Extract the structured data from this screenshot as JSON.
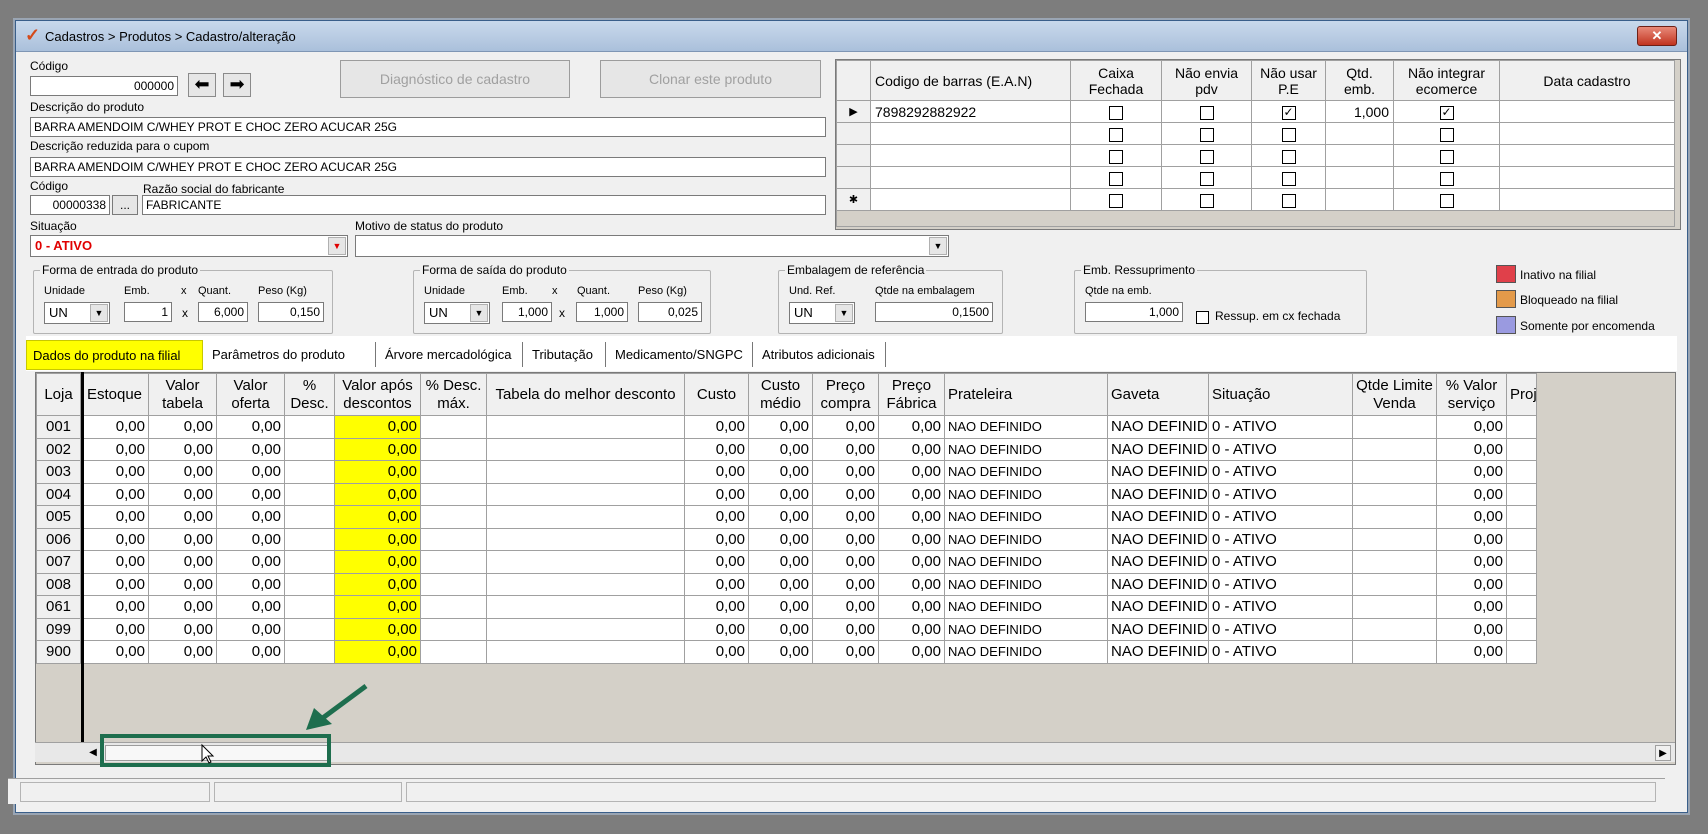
{
  "window": {
    "title": "Cadastros > Produtos > Cadastro/alteração",
    "close": "✕"
  },
  "product": {
    "codigo_label": "Código",
    "codigo": "000000",
    "descricao_label": "Descrição  do produto",
    "descricao": "BARRA AMENDOIM C/WHEY PROT E CHOC ZERO ACUCAR 25G",
    "descricao_cupom_label": "Descrição reduzida para o cupom",
    "descricao_cupom": "BARRA AMENDOIM C/WHEY PROT E CHOC ZERO ACUCAR 25G",
    "fab_codigo_label": "Código",
    "fab_codigo": "00000338",
    "fab_lookup": "...",
    "razao_label": "Razão social do fabricante",
    "razao": "FABRICANTE",
    "situacao_label": "Situação",
    "situacao": "0 - ATIVO",
    "motivo_label": "Motivo de status do produto",
    "motivo": ""
  },
  "buttons": {
    "diagnostico": "Diagnóstico de cadastro",
    "clonar": "Clonar este produto"
  },
  "ean_grid": {
    "headers": [
      "Codigo de barras (E.A.N)",
      "Caixa\nFechada",
      "Não envia\npdv",
      "Não usar\nP.E",
      "Qtd.\nemb.",
      "Não integrar\necomerce",
      "Data cadastro"
    ],
    "rows": [
      {
        "indicator": "▶",
        "ean": "7898292882922",
        "caixa": false,
        "nao_envia": false,
        "nao_usar": true,
        "qtd": "1,000",
        "nao_integrar": true,
        "data": ""
      },
      {
        "indicator": "",
        "ean": "",
        "caixa": false,
        "nao_envia": false,
        "nao_usar": false,
        "qtd": "",
        "nao_integrar": false,
        "data": ""
      },
      {
        "indicator": "",
        "ean": "",
        "caixa": false,
        "nao_envia": false,
        "nao_usar": false,
        "qtd": "",
        "nao_integrar": false,
        "data": ""
      },
      {
        "indicator": "",
        "ean": "",
        "caixa": false,
        "nao_envia": false,
        "nao_usar": false,
        "qtd": "",
        "nao_integrar": false,
        "data": ""
      },
      {
        "indicator": "✱",
        "ean": "",
        "caixa": false,
        "nao_envia": false,
        "nao_usar": false,
        "qtd": "",
        "nao_integrar": false,
        "data": ""
      }
    ]
  },
  "entrada": {
    "title": "Forma de entrada do produto",
    "unidade_label": "Unidade",
    "emb_label": "Emb.",
    "x": "x",
    "quant_label": "Quant.",
    "peso_label": "Peso (Kg)",
    "unidade": "UN",
    "emb": "1",
    "quant": "6,000",
    "peso": "0,150"
  },
  "saida": {
    "title": "Forma de saída do produto",
    "unidade_label": "Unidade",
    "emb_label": "Emb.",
    "x": "x",
    "quant_label": "Quant.",
    "peso_label": "Peso (Kg)",
    "unidade": "UN",
    "emb": "1,000",
    "quant": "1,000",
    "peso": "0,025"
  },
  "referencia": {
    "title": "Embalagem de referência",
    "und_label": "Und. Ref.",
    "qtde_label": "Qtde na embalagem",
    "und": "UN",
    "qtde": "0,1500"
  },
  "ressup": {
    "title": "Emb. Ressuprimento",
    "qtde_label": "Qtde na emb.",
    "qtde": "1,000",
    "check_label": "Ressup. em cx fechada"
  },
  "legend": [
    {
      "label": "Inativo na filial",
      "color": "#e0404a"
    },
    {
      "label": "Bloqueado na filial",
      "color": "#e39a4a"
    },
    {
      "label": "Somente por encomenda",
      "color": "#9a9ae0"
    }
  ],
  "tabs": [
    "Dados do produto na filial",
    "Parâmetros do produto",
    "Árvore mercadológica",
    "Tributação",
    "Medicamento/SNGPC",
    "Atributos adicionais"
  ],
  "main_grid": {
    "headers": [
      "Loja",
      "Estoque",
      "Valor\ntabela",
      "Valor\noferta",
      "%\nDesc.",
      "Valor após\ndescontos",
      "% Desc.\nmáx.",
      "Tabela do melhor desconto",
      "Custo",
      "Custo\nmédio",
      "Preço\ncompra",
      "Preço\nFábrica",
      "Prateleira",
      "Gaveta",
      "Situação",
      "Qtde Limite\nVenda",
      "% Valor\nserviço",
      "Proj"
    ],
    "rows": [
      [
        "001",
        "0,00",
        "0,00",
        "0,00",
        "",
        "0,00",
        "",
        "",
        "0,00",
        "0,00",
        "0,00",
        "0,00",
        "NAO DEFINIDO",
        "NAO DEFINIDO",
        "0 - ATIVO",
        "",
        "0,00",
        ""
      ],
      [
        "002",
        "0,00",
        "0,00",
        "0,00",
        "",
        "0,00",
        "",
        "",
        "0,00",
        "0,00",
        "0,00",
        "0,00",
        "NAO DEFINIDO",
        "NAO DEFINIDO",
        "0 - ATIVO",
        "",
        "0,00",
        ""
      ],
      [
        "003",
        "0,00",
        "0,00",
        "0,00",
        "",
        "0,00",
        "",
        "",
        "0,00",
        "0,00",
        "0,00",
        "0,00",
        "NAO DEFINIDO",
        "NAO DEFINIDO",
        "0 - ATIVO",
        "",
        "0,00",
        ""
      ],
      [
        "004",
        "0,00",
        "0,00",
        "0,00",
        "",
        "0,00",
        "",
        "",
        "0,00",
        "0,00",
        "0,00",
        "0,00",
        "NAO DEFINIDO",
        "NAO DEFINIDO",
        "0 - ATIVO",
        "",
        "0,00",
        ""
      ],
      [
        "005",
        "0,00",
        "0,00",
        "0,00",
        "",
        "0,00",
        "",
        "",
        "0,00",
        "0,00",
        "0,00",
        "0,00",
        "NAO DEFINIDO",
        "NAO DEFINIDO",
        "0 - ATIVO",
        "",
        "0,00",
        ""
      ],
      [
        "006",
        "0,00",
        "0,00",
        "0,00",
        "",
        "0,00",
        "",
        "",
        "0,00",
        "0,00",
        "0,00",
        "0,00",
        "NAO DEFINIDO",
        "NAO DEFINIDO",
        "0 - ATIVO",
        "",
        "0,00",
        ""
      ],
      [
        "007",
        "0,00",
        "0,00",
        "0,00",
        "",
        "0,00",
        "",
        "",
        "0,00",
        "0,00",
        "0,00",
        "0,00",
        "NAO DEFINIDO",
        "NAO DEFINIDO",
        "0 - ATIVO",
        "",
        "0,00",
        ""
      ],
      [
        "008",
        "0,00",
        "0,00",
        "0,00",
        "",
        "0,00",
        "",
        "",
        "0,00",
        "0,00",
        "0,00",
        "0,00",
        "NAO DEFINIDO",
        "NAO DEFINIDO",
        "0 - ATIVO",
        "",
        "0,00",
        ""
      ],
      [
        "061",
        "0,00",
        "0,00",
        "0,00",
        "",
        "0,00",
        "",
        "",
        "0,00",
        "0,00",
        "0,00",
        "0,00",
        "NAO DEFINIDO",
        "NAO DEFINIDO",
        "0 - ATIVO",
        "",
        "0,00",
        ""
      ],
      [
        "099",
        "0,00",
        "0,00",
        "0,00",
        "",
        "0,00",
        "",
        "",
        "0,00",
        "0,00",
        "0,00",
        "0,00",
        "NAO DEFINIDO",
        "NAO DEFINIDO",
        "0 - ATIVO",
        "",
        "0,00",
        ""
      ],
      [
        "900",
        "0,00",
        "0,00",
        "0,00",
        "",
        "0,00",
        "",
        "",
        "0,00",
        "0,00",
        "0,00",
        "0,00",
        "NAO DEFINIDO",
        "NAO DEFINIDO",
        "0 - ATIVO",
        "",
        "0,00",
        ""
      ]
    ]
  },
  "annotation_color": "#1e6e4e"
}
